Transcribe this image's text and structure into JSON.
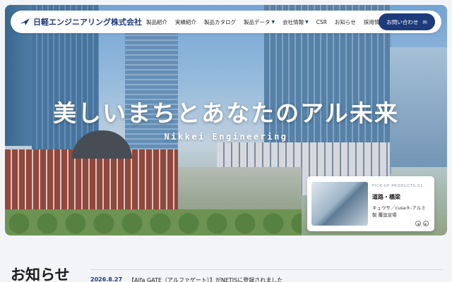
{
  "header": {
    "logo_text": "日軽エンジニアリング株式会社",
    "nav": [
      {
        "label": "製品紹介",
        "has_dropdown": false
      },
      {
        "label": "実績紹介",
        "has_dropdown": false
      },
      {
        "label": "製品カタログ",
        "has_dropdown": false
      },
      {
        "label": "製品データ",
        "has_dropdown": true
      },
      {
        "label": "会社情報",
        "has_dropdown": true
      },
      {
        "label": "CSR",
        "has_dropdown": false
      },
      {
        "label": "お知らせ",
        "has_dropdown": false
      },
      {
        "label": "採用情報",
        "has_dropdown": false
      }
    ],
    "contact_label": "お問い合わせ",
    "contact_icon": "mail-icon",
    "caret_glyph": "▼",
    "mail_glyph": "✉"
  },
  "hero": {
    "headline": "美しいまちとあなたのアル未来",
    "subline": "Nikkei Engineering"
  },
  "pickup": {
    "eyebrow": "PICK UP PRODUCTS 01",
    "title": "道路・橋梁",
    "description": "キュウサ／cusa®-アルミ製 覆設足場",
    "prev_glyph": "◀",
    "next_glyph": "▶"
  },
  "news": {
    "heading": "お知らせ",
    "items": [
      {
        "date": "2026.8.27",
        "text": "【Alfa GATE（アルファゲート）】がNETISに登録されました"
      }
    ]
  },
  "colors": {
    "brand": "#1d3a7a",
    "background": "#f2f4f7"
  }
}
